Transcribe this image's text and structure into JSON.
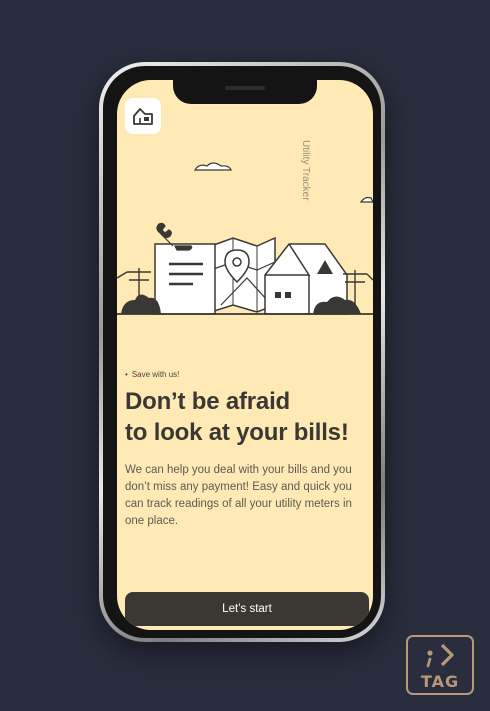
{
  "app": {
    "title": "Utility Tracker"
  },
  "onboarding": {
    "tagline": "Save with us!",
    "headline_line1": "Don’t be afraid",
    "headline_line2": "to look at your bills!",
    "description": "We can help you deal with your bills and you don’t miss any payment! Easy and quick you can track readings of all your utility meters in one place.",
    "primary_button": "Let’s start"
  },
  "badge": {
    "text": "TAG"
  },
  "colors": {
    "background": "#292d3d",
    "screen": "#ffeab6",
    "ink": "#3a3834",
    "button": "#3b3834",
    "badge": "#b8977a"
  },
  "icons": {
    "logo": "house-icon",
    "illustration": "houses-and-map-illustration",
    "badge": "tag-logo-icon"
  }
}
